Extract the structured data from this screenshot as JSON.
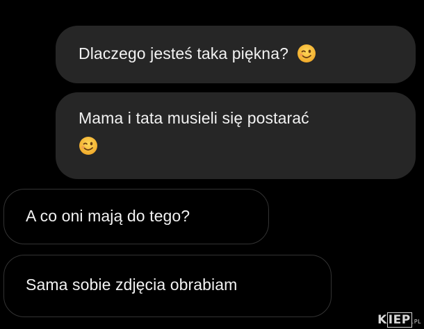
{
  "conversation": {
    "messages": [
      {
        "direction": "sent",
        "text": "Dlaczego jesteś taka piękna?",
        "emoji": "wink-emoji"
      },
      {
        "direction": "sent",
        "text": "Mama i tata musieli się postarać",
        "emoji": "wink-emoji"
      },
      {
        "direction": "received",
        "text": "A co oni mają do tego?"
      },
      {
        "direction": "received",
        "text": "Sama sobie zdjęcia obrabiam"
      }
    ]
  },
  "watermark": {
    "prefix": "K",
    "boxed": "IEP",
    "tld": ".PL"
  },
  "colors": {
    "background": "#000000",
    "sent_bubble": "#262626",
    "received_border": "#333333",
    "text": "#f2f2f2",
    "emoji_face": "#f7c33b"
  }
}
